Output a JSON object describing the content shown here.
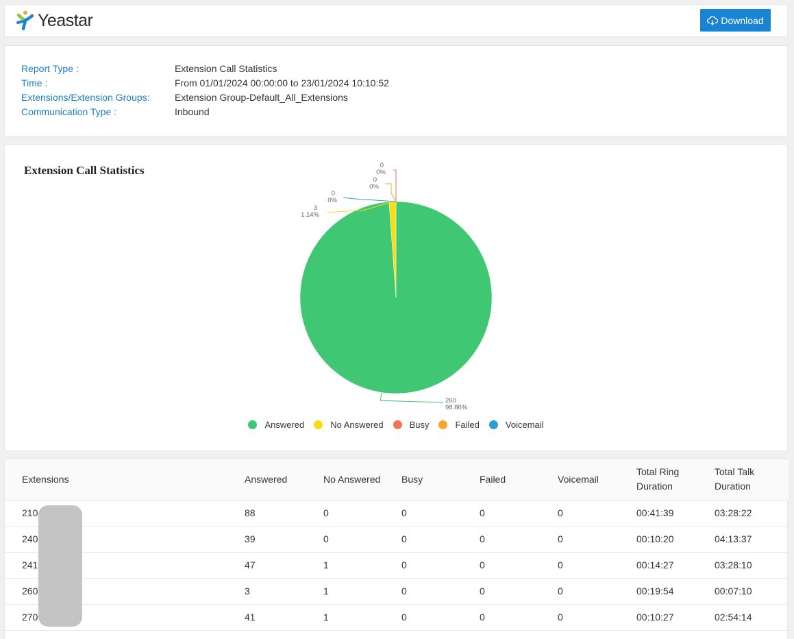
{
  "header": {
    "logo_text": "Yeastar",
    "download_label": "Download"
  },
  "info": {
    "rows": [
      {
        "label": "Report Type :",
        "value": "Extension Call Statistics"
      },
      {
        "label": "Time :",
        "value": "From 01/01/2024 00:00:00 to 23/01/2024 10:10:52"
      },
      {
        "label": "Extensions/Extension Groups:",
        "value": "Extension Group-Default_All_Extensions"
      },
      {
        "label": "Communication Type :",
        "value": "Inbound"
      }
    ]
  },
  "chart_data": {
    "type": "pie",
    "title": "Extension Call Statistics",
    "slices": [
      {
        "name": "Answered",
        "value": 260,
        "percent": "98.86%",
        "color": "#40c774"
      },
      {
        "name": "No Answered",
        "value": 3,
        "percent": "1.14%",
        "color": "#fadb14"
      },
      {
        "name": "Busy",
        "value": 0,
        "percent": "0%",
        "color": "#f2735a"
      },
      {
        "name": "Failed",
        "value": 0,
        "percent": "0%",
        "color": "#f7a52f"
      },
      {
        "name": "Voicemail",
        "value": 0,
        "percent": "0%",
        "color": "#2e9ad9"
      }
    ],
    "legend_position": "bottom"
  },
  "table": {
    "headers": [
      "Extensions",
      "Answered",
      "No Answered",
      "Busy",
      "Failed",
      "Voicemail",
      "Total Ring Duration",
      "Total Talk Duration"
    ],
    "rows": [
      [
        "210-",
        "88",
        "0",
        "0",
        "0",
        "0",
        "00:41:39",
        "03:28:22"
      ],
      [
        "240",
        "39",
        "0",
        "0",
        "0",
        "0",
        "00:10:20",
        "04:13:37"
      ],
      [
        "241",
        "47",
        "1",
        "0",
        "0",
        "0",
        "00:14:27",
        "03:28:10"
      ],
      [
        "260",
        "3",
        "1",
        "0",
        "0",
        "0",
        "00:19:54",
        "00:07:10"
      ],
      [
        "270-",
        "41",
        "1",
        "0",
        "0",
        "0",
        "00:10:27",
        "02:54:14"
      ]
    ]
  }
}
